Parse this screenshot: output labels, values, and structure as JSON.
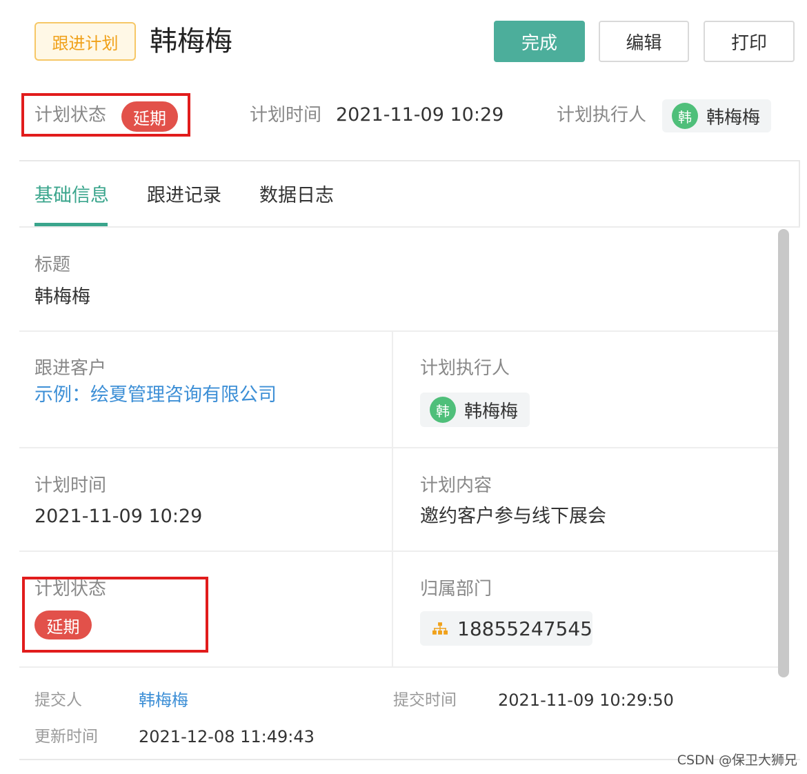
{
  "header": {
    "type_tag": "跟进计划",
    "title": "韩梅梅",
    "buttons": {
      "complete": "完成",
      "edit": "编辑",
      "print": "打印"
    }
  },
  "summary": {
    "status_label": "计划状态",
    "status_value": "延期",
    "time_label": "计划时间",
    "time_value": "2021-11-09 10:29",
    "executor_label": "计划执行人",
    "executor_avatar": "韩",
    "executor_name": "韩梅梅"
  },
  "tabs": [
    {
      "label": "基础信息",
      "active": true
    },
    {
      "label": "跟进记录",
      "active": false
    },
    {
      "label": "数据日志",
      "active": false
    }
  ],
  "fields": {
    "title_label": "标题",
    "title_value": "韩梅梅",
    "customer_label": "跟进客户",
    "customer_value": "示例：绘夏管理咨询有限公司",
    "executor_label": "计划执行人",
    "executor_avatar": "韩",
    "executor_name": "韩梅梅",
    "time_label": "计划时间",
    "time_value": "2021-11-09 10:29",
    "content_label": "计划内容",
    "content_value": "邀约客户参与线下展会",
    "status_label": "计划状态",
    "status_value": "延期",
    "dept_label": "归属部门",
    "dept_icon": "org-tree-icon",
    "dept_value": "18855247545"
  },
  "footer": {
    "submitter_label": "提交人",
    "submitter_value": "韩梅梅",
    "submit_time_label": "提交时间",
    "submit_time_value": "2021-11-09 10:29:50",
    "update_time_label": "更新时间",
    "update_time_value": "2021-12-08 11:49:43"
  },
  "watermark": "CSDN @保卫大狮兄",
  "colors": {
    "accent": "#3aa58c",
    "primary_button": "#4cae9b",
    "status_red": "#e2514a",
    "link_blue": "#3d8fd6",
    "tag_orange": "#f0a11a",
    "avatar_green": "#4fbf7a",
    "highlight_box": "#e11c1c"
  }
}
